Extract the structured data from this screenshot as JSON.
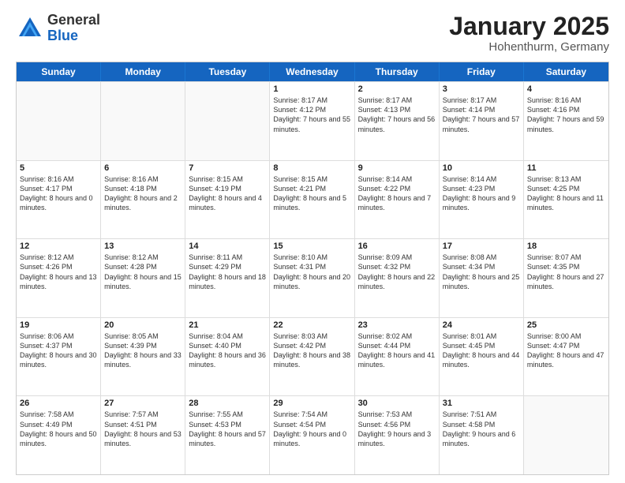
{
  "logo": {
    "general": "General",
    "blue": "Blue"
  },
  "title": "January 2025",
  "subtitle": "Hohenthurm, Germany",
  "header_days": [
    "Sunday",
    "Monday",
    "Tuesday",
    "Wednesday",
    "Thursday",
    "Friday",
    "Saturday"
  ],
  "weeks": [
    [
      {
        "day": "",
        "sunrise": "",
        "sunset": "",
        "daylight": ""
      },
      {
        "day": "",
        "sunrise": "",
        "sunset": "",
        "daylight": ""
      },
      {
        "day": "",
        "sunrise": "",
        "sunset": "",
        "daylight": ""
      },
      {
        "day": "1",
        "sunrise": "Sunrise: 8:17 AM",
        "sunset": "Sunset: 4:12 PM",
        "daylight": "Daylight: 7 hours and 55 minutes."
      },
      {
        "day": "2",
        "sunrise": "Sunrise: 8:17 AM",
        "sunset": "Sunset: 4:13 PM",
        "daylight": "Daylight: 7 hours and 56 minutes."
      },
      {
        "day": "3",
        "sunrise": "Sunrise: 8:17 AM",
        "sunset": "Sunset: 4:14 PM",
        "daylight": "Daylight: 7 hours and 57 minutes."
      },
      {
        "day": "4",
        "sunrise": "Sunrise: 8:16 AM",
        "sunset": "Sunset: 4:16 PM",
        "daylight": "Daylight: 7 hours and 59 minutes."
      }
    ],
    [
      {
        "day": "5",
        "sunrise": "Sunrise: 8:16 AM",
        "sunset": "Sunset: 4:17 PM",
        "daylight": "Daylight: 8 hours and 0 minutes."
      },
      {
        "day": "6",
        "sunrise": "Sunrise: 8:16 AM",
        "sunset": "Sunset: 4:18 PM",
        "daylight": "Daylight: 8 hours and 2 minutes."
      },
      {
        "day": "7",
        "sunrise": "Sunrise: 8:15 AM",
        "sunset": "Sunset: 4:19 PM",
        "daylight": "Daylight: 8 hours and 4 minutes."
      },
      {
        "day": "8",
        "sunrise": "Sunrise: 8:15 AM",
        "sunset": "Sunset: 4:21 PM",
        "daylight": "Daylight: 8 hours and 5 minutes."
      },
      {
        "day": "9",
        "sunrise": "Sunrise: 8:14 AM",
        "sunset": "Sunset: 4:22 PM",
        "daylight": "Daylight: 8 hours and 7 minutes."
      },
      {
        "day": "10",
        "sunrise": "Sunrise: 8:14 AM",
        "sunset": "Sunset: 4:23 PM",
        "daylight": "Daylight: 8 hours and 9 minutes."
      },
      {
        "day": "11",
        "sunrise": "Sunrise: 8:13 AM",
        "sunset": "Sunset: 4:25 PM",
        "daylight": "Daylight: 8 hours and 11 minutes."
      }
    ],
    [
      {
        "day": "12",
        "sunrise": "Sunrise: 8:12 AM",
        "sunset": "Sunset: 4:26 PM",
        "daylight": "Daylight: 8 hours and 13 minutes."
      },
      {
        "day": "13",
        "sunrise": "Sunrise: 8:12 AM",
        "sunset": "Sunset: 4:28 PM",
        "daylight": "Daylight: 8 hours and 15 minutes."
      },
      {
        "day": "14",
        "sunrise": "Sunrise: 8:11 AM",
        "sunset": "Sunset: 4:29 PM",
        "daylight": "Daylight: 8 hours and 18 minutes."
      },
      {
        "day": "15",
        "sunrise": "Sunrise: 8:10 AM",
        "sunset": "Sunset: 4:31 PM",
        "daylight": "Daylight: 8 hours and 20 minutes."
      },
      {
        "day": "16",
        "sunrise": "Sunrise: 8:09 AM",
        "sunset": "Sunset: 4:32 PM",
        "daylight": "Daylight: 8 hours and 22 minutes."
      },
      {
        "day": "17",
        "sunrise": "Sunrise: 8:08 AM",
        "sunset": "Sunset: 4:34 PM",
        "daylight": "Daylight: 8 hours and 25 minutes."
      },
      {
        "day": "18",
        "sunrise": "Sunrise: 8:07 AM",
        "sunset": "Sunset: 4:35 PM",
        "daylight": "Daylight: 8 hours and 27 minutes."
      }
    ],
    [
      {
        "day": "19",
        "sunrise": "Sunrise: 8:06 AM",
        "sunset": "Sunset: 4:37 PM",
        "daylight": "Daylight: 8 hours and 30 minutes."
      },
      {
        "day": "20",
        "sunrise": "Sunrise: 8:05 AM",
        "sunset": "Sunset: 4:39 PM",
        "daylight": "Daylight: 8 hours and 33 minutes."
      },
      {
        "day": "21",
        "sunrise": "Sunrise: 8:04 AM",
        "sunset": "Sunset: 4:40 PM",
        "daylight": "Daylight: 8 hours and 36 minutes."
      },
      {
        "day": "22",
        "sunrise": "Sunrise: 8:03 AM",
        "sunset": "Sunset: 4:42 PM",
        "daylight": "Daylight: 8 hours and 38 minutes."
      },
      {
        "day": "23",
        "sunrise": "Sunrise: 8:02 AM",
        "sunset": "Sunset: 4:44 PM",
        "daylight": "Daylight: 8 hours and 41 minutes."
      },
      {
        "day": "24",
        "sunrise": "Sunrise: 8:01 AM",
        "sunset": "Sunset: 4:45 PM",
        "daylight": "Daylight: 8 hours and 44 minutes."
      },
      {
        "day": "25",
        "sunrise": "Sunrise: 8:00 AM",
        "sunset": "Sunset: 4:47 PM",
        "daylight": "Daylight: 8 hours and 47 minutes."
      }
    ],
    [
      {
        "day": "26",
        "sunrise": "Sunrise: 7:58 AM",
        "sunset": "Sunset: 4:49 PM",
        "daylight": "Daylight: 8 hours and 50 minutes."
      },
      {
        "day": "27",
        "sunrise": "Sunrise: 7:57 AM",
        "sunset": "Sunset: 4:51 PM",
        "daylight": "Daylight: 8 hours and 53 minutes."
      },
      {
        "day": "28",
        "sunrise": "Sunrise: 7:55 AM",
        "sunset": "Sunset: 4:53 PM",
        "daylight": "Daylight: 8 hours and 57 minutes."
      },
      {
        "day": "29",
        "sunrise": "Sunrise: 7:54 AM",
        "sunset": "Sunset: 4:54 PM",
        "daylight": "Daylight: 9 hours and 0 minutes."
      },
      {
        "day": "30",
        "sunrise": "Sunrise: 7:53 AM",
        "sunset": "Sunset: 4:56 PM",
        "daylight": "Daylight: 9 hours and 3 minutes."
      },
      {
        "day": "31",
        "sunrise": "Sunrise: 7:51 AM",
        "sunset": "Sunset: 4:58 PM",
        "daylight": "Daylight: 9 hours and 6 minutes."
      },
      {
        "day": "",
        "sunrise": "",
        "sunset": "",
        "daylight": ""
      }
    ]
  ]
}
